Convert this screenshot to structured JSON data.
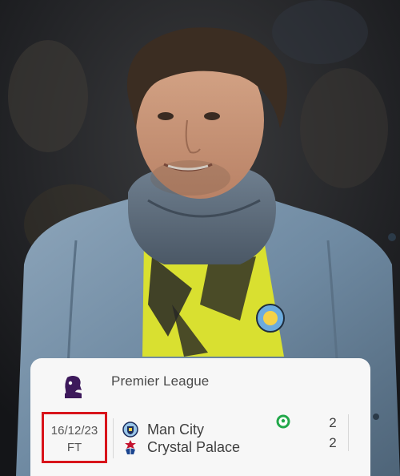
{
  "match": {
    "league": "Premier League",
    "date": "16/12/23",
    "status": "FT",
    "home_team": {
      "name": "Man City",
      "score": "2",
      "crest_icon": "man-city-crest-icon"
    },
    "away_team": {
      "name": "Crystal Palace",
      "score": "2",
      "crest_icon": "crystal-palace-crest-icon"
    },
    "event_icon": "football-icon",
    "highlight_color": "#d8141b",
    "accent_green": "#22a84a"
  }
}
